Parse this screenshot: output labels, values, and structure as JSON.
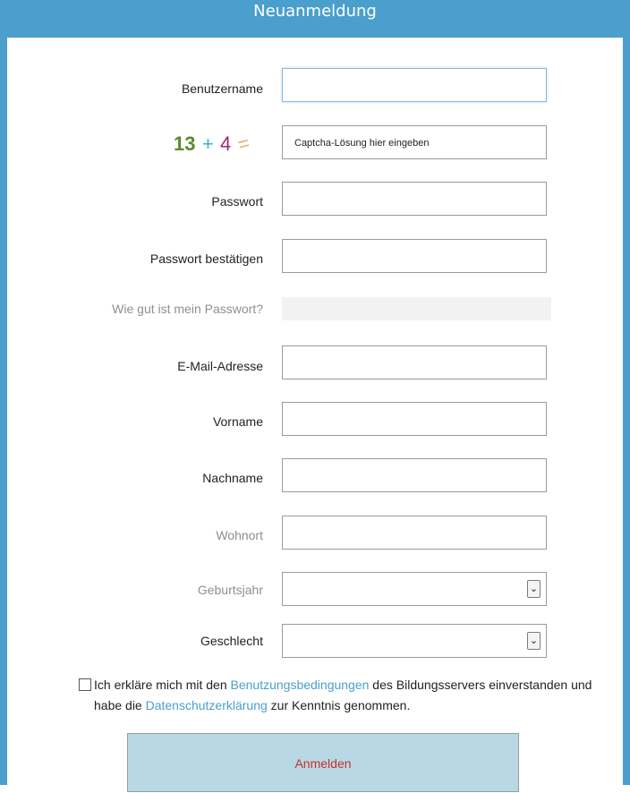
{
  "header": {
    "title": "Neuanmeldung"
  },
  "form": {
    "username_label": "Benutzername",
    "username_value": "",
    "captcha_text": [
      "13",
      "+",
      "4",
      "="
    ],
    "captcha_placeholder": "Captcha-Lösung hier eingeben",
    "password_label": "Passwort",
    "password_confirm_label": "Passwort bestätigen",
    "strength_label": "Wie gut ist mein Passwort?",
    "email_label": "E-Mail-Adresse",
    "firstname_label": "Vorname",
    "lastname_label": "Nachname",
    "city_label": "Wohnort",
    "birthyear_label": "Geburtsjahr",
    "gender_label": "Geschlecht",
    "select_arrow": "⌄"
  },
  "terms": {
    "part1": "Ich erkläre mich mit den ",
    "terms_link": "Benutzungsbedingungen",
    "part2": " des Bildungsservers einverstanden und habe die ",
    "privacy_link": "Datenschutzerklärung",
    "part3": " zur Kenntnis genommen."
  },
  "submit": {
    "label": "Anmelden"
  },
  "colors": {
    "accent": "#4a9fcc",
    "button_bg": "#b7d8e4",
    "button_text": "#c4322c"
  }
}
